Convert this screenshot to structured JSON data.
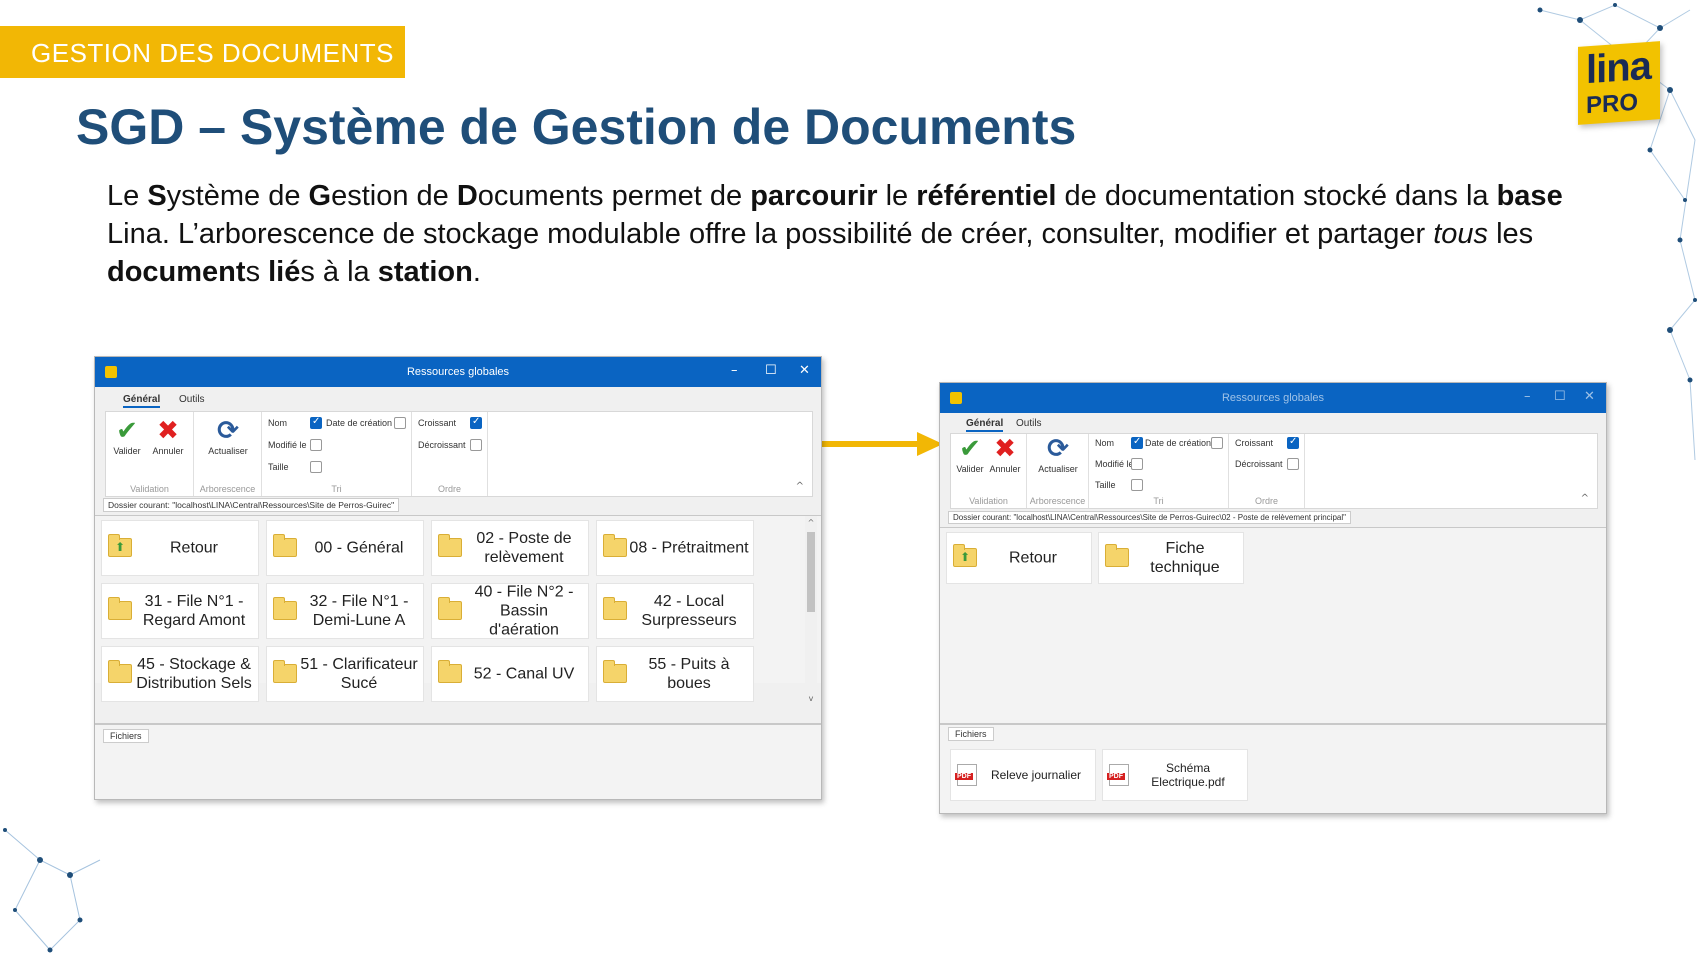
{
  "slide": {
    "banner": "GESTION DES DOCUMENTS",
    "title": "SGD – Système de Gestion de Documents",
    "intro": {
      "p01": "Le ",
      "p02": "S",
      "p03": "ystème de ",
      "p04": "G",
      "p05": "estion de ",
      "p06": "D",
      "p07": "ocuments permet de ",
      "p08": "parcourir",
      "p09": " le ",
      "p10": "référentiel",
      "p11": " de documentation stocké dans la ",
      "p12": "base",
      "p13": " Lina. L’arborescence de stockage modulable offre la possibilité de créer, consulter, modifier et partager ",
      "p14": "tous",
      "p15": " les ",
      "p16": "document",
      "p17": "s ",
      "p18": "lié",
      "p19": "s à la ",
      "p20": "station",
      "p21": "."
    },
    "logo": {
      "line1": "lina",
      "line2": "PRO"
    },
    "arrow_color": "#f2b705"
  },
  "window_left": {
    "title": "Ressources globales",
    "controls": {
      "minimize": "–",
      "maximize": "☐",
      "close": "✕"
    },
    "tabs": [
      "Général",
      "Outils"
    ],
    "ribbon": {
      "validate": "Valider",
      "cancel": "Annuler",
      "refresh": "Actualiser",
      "group_validation": "Validation",
      "group_tree": "Arborescence",
      "group_sort": "Tri",
      "group_order": "Ordre",
      "sort_name": "Nom",
      "sort_created": "Date de création",
      "sort_modified": "Modifié le",
      "sort_size": "Taille",
      "order_asc": "Croissant",
      "order_desc": "Décroissant",
      "collapse": "^"
    },
    "path": "Dossier courant: \"localhost\\LINA\\Central\\Ressources\\Site de Perros-Guirec\"",
    "folders": [
      "Retour",
      "00 - Général",
      "02 - Poste de relèvement",
      "08 - Prétraitment",
      "31 - File N°1 - Regard Amont",
      "32 - File N°1 - Demi-Lune A",
      "40 - File N°2 - Bassin d'aération",
      "42 - Local Surpresseurs",
      "45 - Stockage & Distribution Sels",
      "51 - Clarificateur Sucé",
      "52 - Canal UV",
      "55 - Puits à boues"
    ],
    "scroll_up": "^",
    "scroll_down": "v",
    "files_tab": "Fichiers"
  },
  "window_right": {
    "title": "Ressources globales",
    "controls": {
      "minimize": "–",
      "maximize": "☐",
      "close": "✕"
    },
    "tabs": [
      "Général",
      "Outils"
    ],
    "ribbon": {
      "validate": "Valider",
      "cancel": "Annuler",
      "refresh": "Actualiser",
      "group_validation": "Validation",
      "group_tree": "Arborescence",
      "group_sort": "Tri",
      "group_order": "Ordre",
      "sort_name": "Nom",
      "sort_created": "Date de création",
      "sort_modified": "Modifié le",
      "sort_size": "Taille",
      "order_asc": "Croissant",
      "order_desc": "Décroissant",
      "collapse": "^"
    },
    "path": "Dossier courant: \"localhost\\LINA\\Central\\Ressources\\Site de Perros-Guirec\\02 - Poste de relèvement principal\"",
    "folders": [
      "Retour",
      "Fiche technique"
    ],
    "files_tab": "Fichiers",
    "files": [
      "Releve journalier",
      "Schéma Electrique.pdf"
    ]
  }
}
